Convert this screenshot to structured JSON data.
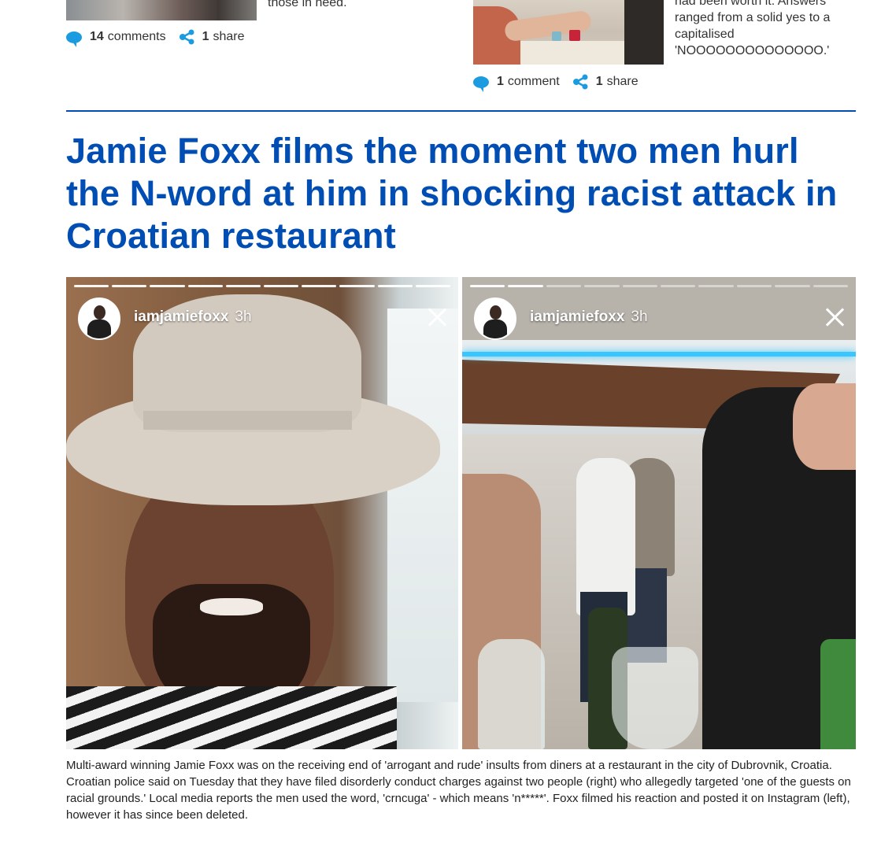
{
  "teasers": {
    "left": {
      "snippet": "those in need.",
      "comments_count": "14",
      "comments_label": "comments",
      "shares_count": "1",
      "shares_label": "share"
    },
    "right": {
      "snippet": "had been worth it. Answers ranged from a solid yes to a capitalised 'NOOOOOOOOOOOOOO.'",
      "comments_count": "1",
      "comments_label": "comment",
      "shares_count": "1",
      "shares_label": "share"
    }
  },
  "article": {
    "headline": "Jamie Foxx films the moment two men hurl the N-word at him in shocking racist attack in Croatian restaurant",
    "caption": "Multi-award winning Jamie Foxx was on the receiving end of 'arrogant and rude' insults from diners at a restaurant in the city of Dubrovnik, Croatia. Croatian police said on Tuesday that they have filed disorderly conduct charges against two people (right) who allegedly targeted 'one of the guests on racial grounds.' Local media reports the men used the word, 'crncuga' - which means 'n*****'. Foxx filmed his reaction and posted it on Instagram (left), however it has since been deleted."
  },
  "stories": {
    "left": {
      "username": "iamjamiefoxx",
      "time": "3h"
    },
    "right": {
      "username": "iamjamiefoxx",
      "time": "3h"
    }
  },
  "colors": {
    "headline": "#004db3",
    "icon_accent": "#1c9be0",
    "divider": "#004db3"
  },
  "icons": [
    "comment-bubble-icon",
    "share-icon",
    "close-icon"
  ]
}
